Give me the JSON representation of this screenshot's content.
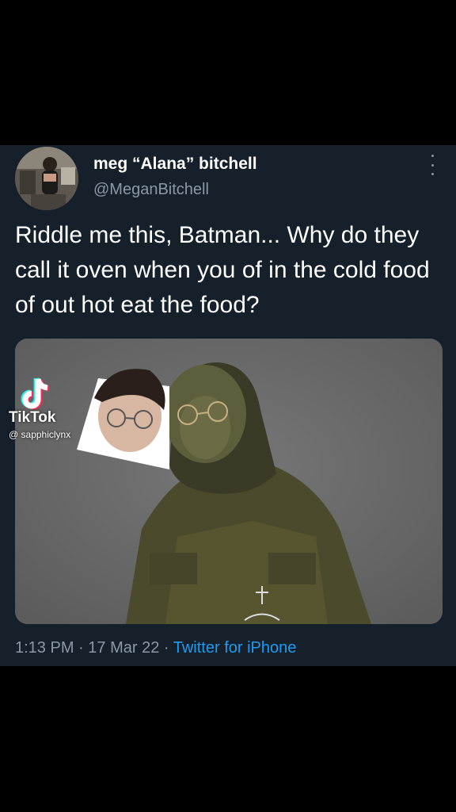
{
  "tweet": {
    "display_name": "meg “Alana” bitchell",
    "handle": "@MeganBitchell",
    "text": "Riddle me this, Batman... Why do they call it oven when you of in the cold food of out hot eat the food?",
    "time": "1:13 PM",
    "separator": " · ",
    "date": "17 Mar 22",
    "source": "Twitter for iPhone"
  },
  "overlay": {
    "brand": "TikTok",
    "username": "@ sapphiclynx"
  },
  "colors": {
    "background": "#15202b",
    "accent": "#1d9bf0",
    "secondary_text": "#8b98a5"
  },
  "icons": [
    "more-options-icon",
    "tiktok-logo-icon"
  ]
}
